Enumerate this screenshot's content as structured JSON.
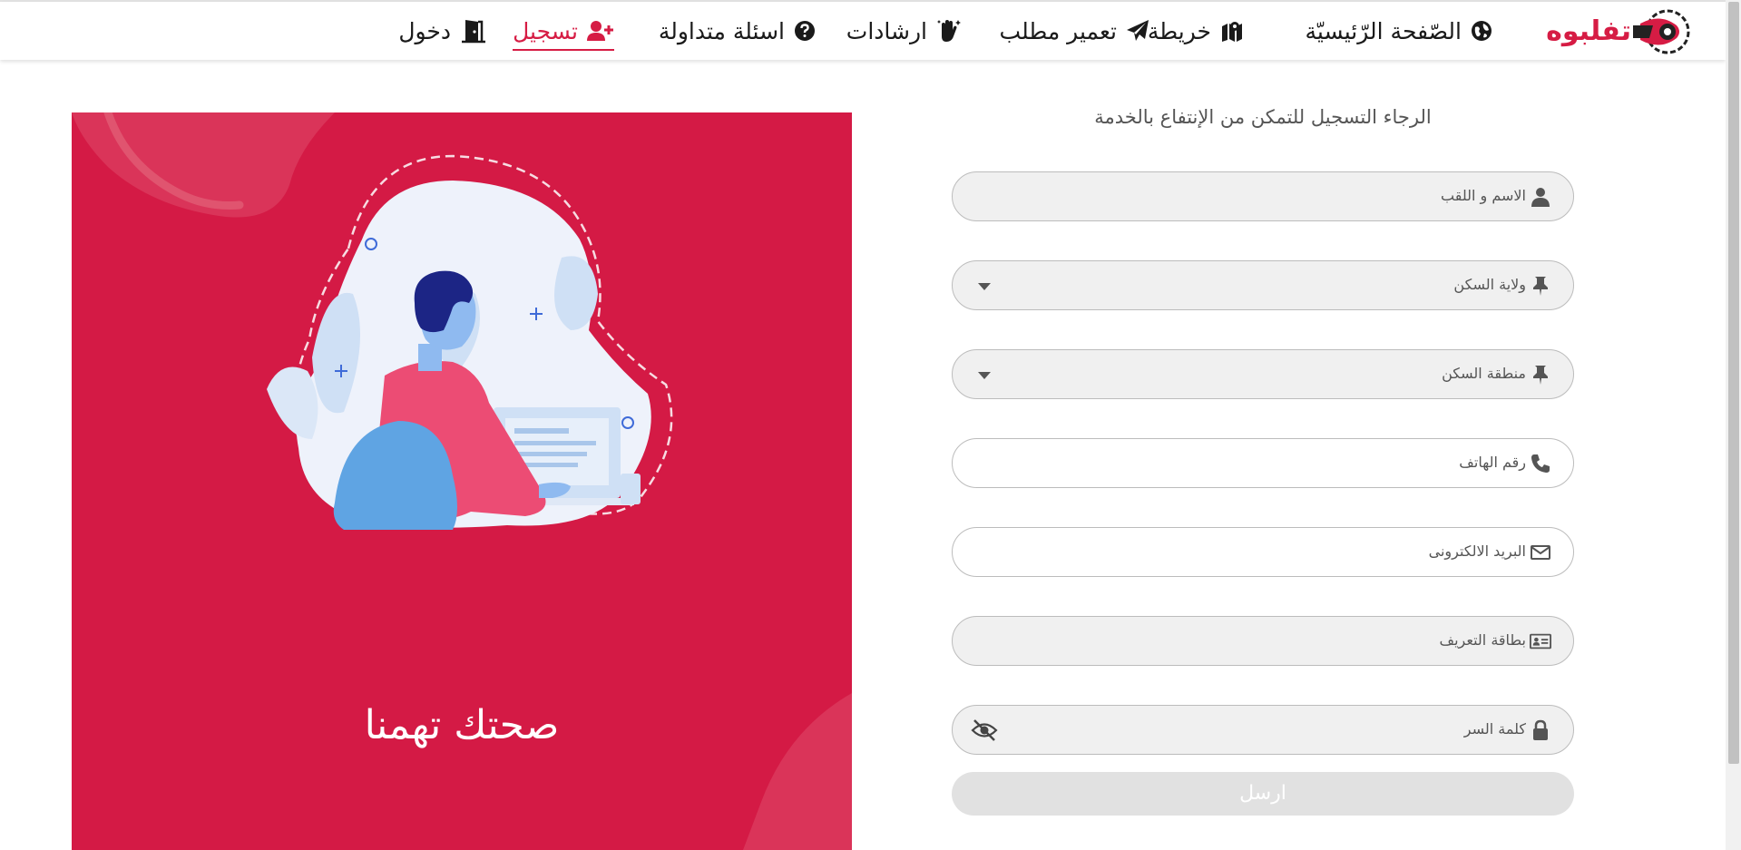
{
  "brand": {
    "name": "تفلبوه",
    "logo_icon": "shield-eye-logo-icon"
  },
  "nav": [
    {
      "label": "الصّفحة الرّئيسيّة",
      "icon": "globe-icon"
    },
    {
      "label": "خريطة",
      "icon": "map-marker-icon"
    },
    {
      "label": "تعمير مطلب",
      "icon": "paper-plane-icon"
    },
    {
      "label": "ارشادات",
      "icon": "hand-sparkles-icon"
    },
    {
      "label": "اسئلة متداولة",
      "icon": "question-circle-icon"
    },
    {
      "label": "تسجيل",
      "icon": "user-plus-icon",
      "active": true
    },
    {
      "label": "دخول",
      "icon": "door-open-icon"
    }
  ],
  "hero": {
    "slogan": "صحتك تهمنا"
  },
  "form": {
    "title": "الرجاء التسجيل للتمكن من الإنتفاع بالخدمة",
    "fields": [
      {
        "label": "الاسم و اللقب",
        "icon": "user-icon"
      },
      {
        "label": "ولاية السكن",
        "icon": "thumbtack-icon",
        "dropdown": true
      },
      {
        "label": "منطقة السكن",
        "icon": "thumbtack-icon",
        "dropdown": true
      },
      {
        "label": "رقم الهاتف",
        "icon": "phone-icon"
      },
      {
        "label": "البريد الالكترونى",
        "icon": "envelope-icon"
      },
      {
        "label": "بطاقة التعريف",
        "icon": "id-card-icon"
      },
      {
        "label": "كلمة السر",
        "icon": "lock-icon",
        "toggle_icon": "eye-slash-icon"
      }
    ],
    "submit_label": "ارسل"
  },
  "colors": {
    "accent": "#d41a45",
    "nav_active": "#d61c44",
    "submit_disabled": "#e1e1e1"
  }
}
